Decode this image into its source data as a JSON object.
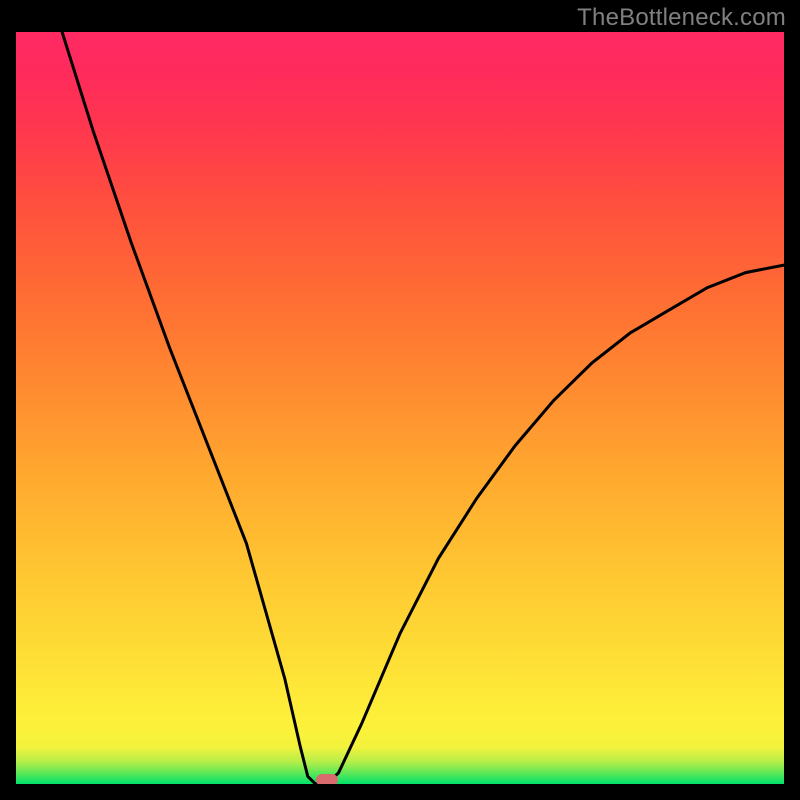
{
  "watermark": "TheBottleneck.com",
  "chart_data": {
    "type": "line",
    "title": "",
    "subtitle": "",
    "xlabel": "",
    "ylabel": "",
    "legend": false,
    "axis_ticks_visible": false,
    "grid": false,
    "xlim": [
      0,
      100
    ],
    "ylim": [
      0,
      100
    ],
    "series": [
      {
        "name": "bottleneck-curve",
        "color": "#000000",
        "x": [
          6,
          10,
          15,
          20,
          25,
          30,
          35,
          37,
          38,
          39,
          40,
          41,
          42,
          45,
          50,
          55,
          60,
          65,
          70,
          75,
          80,
          85,
          90,
          95,
          100
        ],
        "y": [
          100,
          87,
          72,
          58,
          45,
          32,
          14,
          5,
          1,
          0,
          0,
          0.5,
          1.5,
          8,
          20,
          30,
          38,
          45,
          51,
          56,
          60,
          63,
          66,
          68,
          69
        ]
      }
    ],
    "marker": {
      "x": 40.5,
      "y": 0.5,
      "color": "#d96b6f"
    },
    "background_gradient": {
      "type": "vertical",
      "stops": [
        {
          "pos": 0,
          "color": "#00e26b"
        },
        {
          "pos": 5,
          "color": "#f4f23c"
        },
        {
          "pos": 50,
          "color": "#ff8a30"
        },
        {
          "pos": 100,
          "color": "#ff2a63"
        }
      ]
    }
  }
}
